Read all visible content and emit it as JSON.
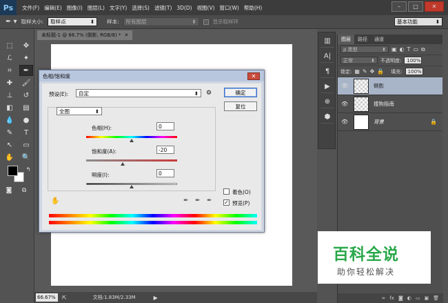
{
  "app": {
    "logo": "Ps"
  },
  "menubar": {
    "items": [
      "文件(F)",
      "编辑(E)",
      "图像(I)",
      "图层(L)",
      "文字(Y)",
      "选择(S)",
      "滤镜(T)",
      "3D(D)",
      "视图(V)",
      "窗口(W)",
      "帮助(H)"
    ],
    "window_controls": [
      "–",
      "□",
      "✕"
    ]
  },
  "options_bar": {
    "sample_size_label": "取样大小:",
    "sample_size_value": "取样点",
    "sample_label": "样本:",
    "sample_value": "所有图层",
    "show_ring_label": "显示取样环",
    "workspace_value": "基本功能"
  },
  "document": {
    "tab_title": "未标题-1 @ 66.7% (倒影, RGB/8) *",
    "zoom": "66.67%",
    "doc_info": "文档:1.83M/2.33M"
  },
  "layers_panel": {
    "tabs": [
      "图层",
      "路径",
      "通道"
    ],
    "filter_value": "ρ 类型",
    "blend_mode": "正常",
    "opacity_label": "不透明度:",
    "opacity_value": "100%",
    "lock_label": "锁定:",
    "fill_label": "填充:",
    "fill_value": "100%",
    "layers": [
      {
        "name": "倒影",
        "selected": true
      },
      {
        "name": "搜狗指南",
        "selected": false
      },
      {
        "name": "背景",
        "selected": false
      }
    ]
  },
  "dialog": {
    "title": "色相/饱和度",
    "preset_label": "预设(E):",
    "preset_value": "自定",
    "ok_label": "确定",
    "reset_label": "复位",
    "channel_value": "全图",
    "hue_label": "色相(H):",
    "hue_value": "0",
    "saturation_label": "饱和度(A):",
    "saturation_value": "-20",
    "lightness_label": "明度(I):",
    "lightness_value": "0",
    "colorize_label": "着色(O)",
    "preview_label": "预览(P)",
    "preview_checked": "✓"
  },
  "watermark": {
    "title": "百科全说",
    "subtitle": "助你轻松解决"
  }
}
